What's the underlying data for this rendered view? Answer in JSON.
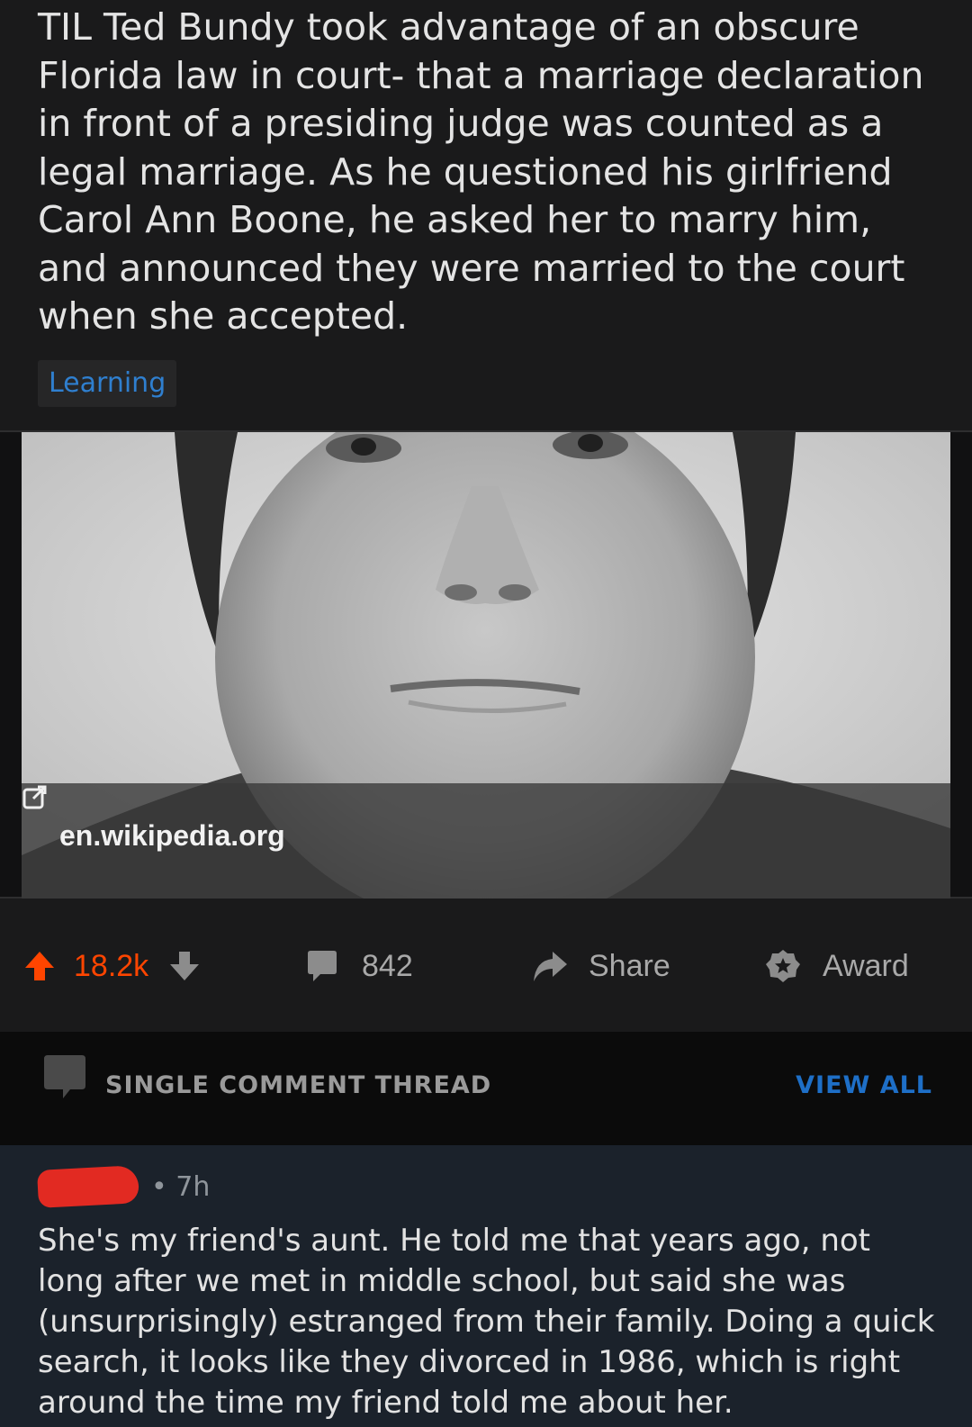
{
  "post": {
    "title": "TIL Ted Bundy took advantage of an obscure Florida law in court- that a marriage declaration in front of a presiding judge was counted as a legal marriage. As he questioned his girlfriend Carol Ann Boone, he asked her to marry him, and announced they were married to the court when she accepted.",
    "flair": "Learning",
    "link_domain": "en.wikipedia.org"
  },
  "actions": {
    "upvote_count": "18.2k",
    "comment_count": "842",
    "share_label": "Share",
    "award_label": "Award"
  },
  "thread": {
    "title": "SINGLE COMMENT THREAD",
    "view_all": "VIEW ALL"
  },
  "comment": {
    "time": "• 7h",
    "body": "She's my friend's aunt. He told me that years ago, not long after we met in middle school, but said she was (unsurprisingly) estranged from their family. Doing a quick search, it looks like they divorced in 1986, which is right around the time my friend told me about her."
  },
  "colors": {
    "background": "#1a1a1b",
    "upvote": "#ff4500",
    "link_blue": "#1e6fc7",
    "redaction": "#e22a22"
  },
  "icons": {
    "upvote": "upvote-arrow-icon",
    "downvote": "downvote-arrow-icon",
    "comments": "comment-bubble-icon",
    "share": "share-arrow-icon",
    "award": "award-star-icon",
    "external": "external-link-icon",
    "thread": "comment-thread-icon"
  }
}
